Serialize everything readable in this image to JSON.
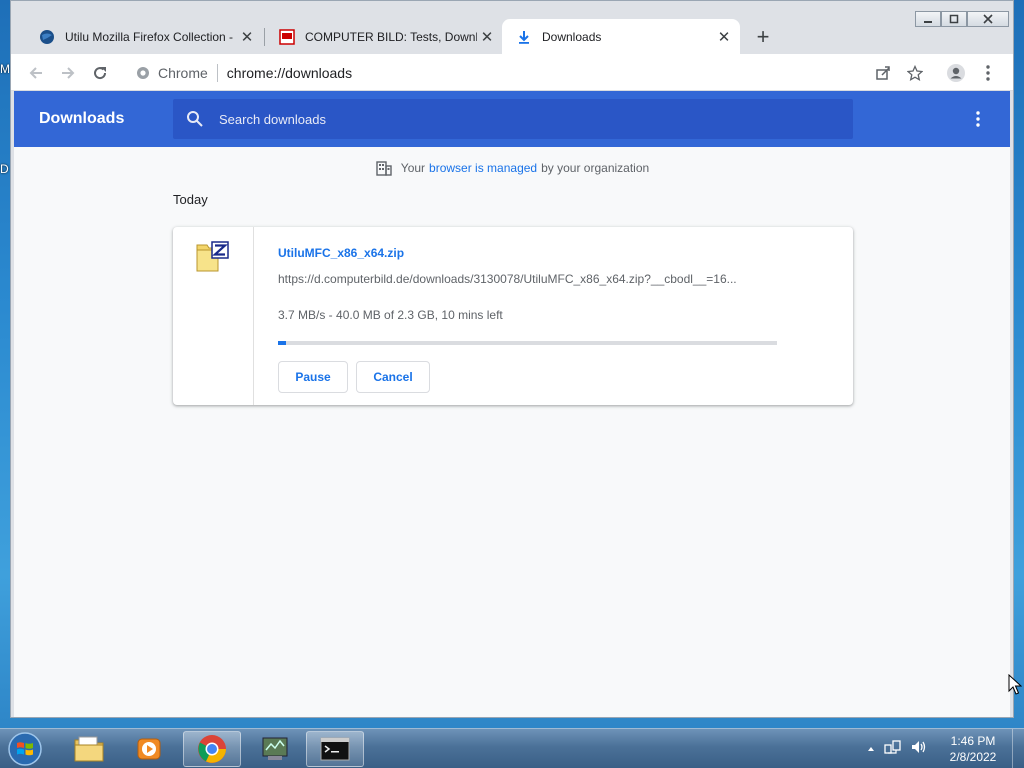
{
  "desktop": {
    "edge_letters": [
      "M",
      "D"
    ]
  },
  "tabs": [
    {
      "title": "Utilu Mozilla Firefox Collection - ",
      "icon": "globe-icon",
      "active": false
    },
    {
      "title": "COMPUTER BILD: Tests, Downloa",
      "icon": "computerbild-icon",
      "active": false
    },
    {
      "title": "Downloads",
      "icon": "download-icon",
      "active": true
    }
  ],
  "omnibox": {
    "site_label": "Chrome",
    "url": "chrome://downloads"
  },
  "downloads": {
    "header_title": "Downloads",
    "search_placeholder": "Search downloads",
    "managed_notice": {
      "prefix": "Your",
      "link": "browser is managed",
      "suffix": "by your organization"
    },
    "section_date": "Today",
    "items": [
      {
        "file_name": "UtiluMFC_x86_x64.zip",
        "url": "https://d.computerbild.de/downloads/3130078/UtiluMFC_x86_x64.zip?__cbodl__=16...",
        "status": "3.7 MB/s - 40.0 MB of 2.3 GB, 10 mins left",
        "progress_fraction": 0.017,
        "pause_label": "Pause",
        "cancel_label": "Cancel"
      }
    ]
  },
  "taskbar": {
    "apps": [
      "windows-explorer",
      "media-player",
      "chrome",
      "network-tool",
      "command-prompt"
    ],
    "time": "1:46 PM",
    "date": "2/8/2022"
  },
  "colors": {
    "accent": "#3367d6",
    "search_bg": "#2a56c6",
    "link": "#1a73e8"
  }
}
